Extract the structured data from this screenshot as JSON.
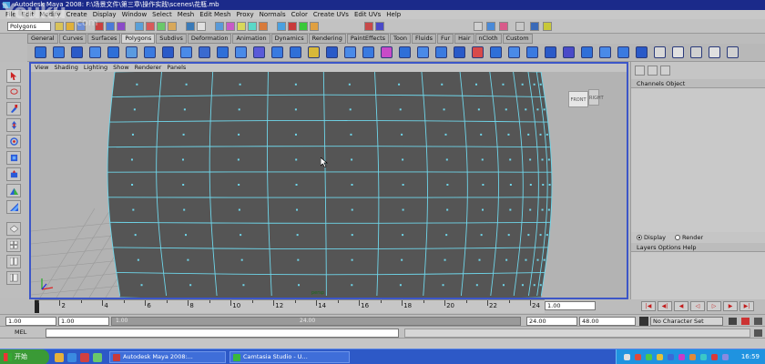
{
  "window": {
    "title": "Autodesk Maya 2008: F:\\场景文件\\第三章\\操作实践\\scenes\\花瓶.mb"
  },
  "watermark": {
    "main": "Youku",
    "sub": "com"
  },
  "menus": [
    "File",
    "Edit",
    "Modify",
    "Create",
    "Display",
    "Window",
    "Select",
    "Mesh",
    "Edit Mesh",
    "Proxy",
    "Normals",
    "Color",
    "Create UVs",
    "Edit UVs",
    "Help"
  ],
  "status_line": {
    "mode": "Polygons"
  },
  "shelf_tabs": [
    "General",
    "Curves",
    "Surfaces",
    "Polygons",
    "Subdivs",
    "Deformation",
    "Animation",
    "Dynamics",
    "Rendering",
    "PaintEffects",
    "Toon",
    "Fluids",
    "Fur",
    "Hair",
    "nCloth",
    "Custom"
  ],
  "shelf_active_tab": "Polygons",
  "panel_menu": [
    "View",
    "Shading",
    "Lighting",
    "Show",
    "Renderer",
    "Panels"
  ],
  "viewcube": {
    "front": "FRONT",
    "right": "RIGHT"
  },
  "viewport_label": "persp",
  "channel_box": {
    "header": "Channels  Object"
  },
  "layer_editor": {
    "radio_display": "Display",
    "radio_render": "Render",
    "menu": "Layers  Options  Help"
  },
  "time_slider": {
    "ticks": [
      "2",
      "4",
      "6",
      "8",
      "10",
      "12",
      "14",
      "16",
      "18",
      "20",
      "22",
      "24"
    ],
    "current_time": "1.00"
  },
  "range_slider": {
    "start_time": "1.00",
    "playback_start": "1.00",
    "range_left_label": "1.00",
    "range_right_label": "24.00",
    "playback_end": "24.00",
    "end_time": "48.00",
    "character_set": "No Character Set"
  },
  "command_line": {
    "label": "MEL"
  },
  "taskbar": {
    "start": "开始",
    "tasks": [
      "Autodesk Maya 2008:...",
      "Camtasia Studio - U..."
    ],
    "clock": "16:59"
  },
  "colors": {
    "title_bar": "#1b2a8a",
    "viewport_border": "#3c56c8",
    "wireframe": "#6fd6ea",
    "mesh_fill": "#555555",
    "taskbar": "#2d59c7"
  }
}
